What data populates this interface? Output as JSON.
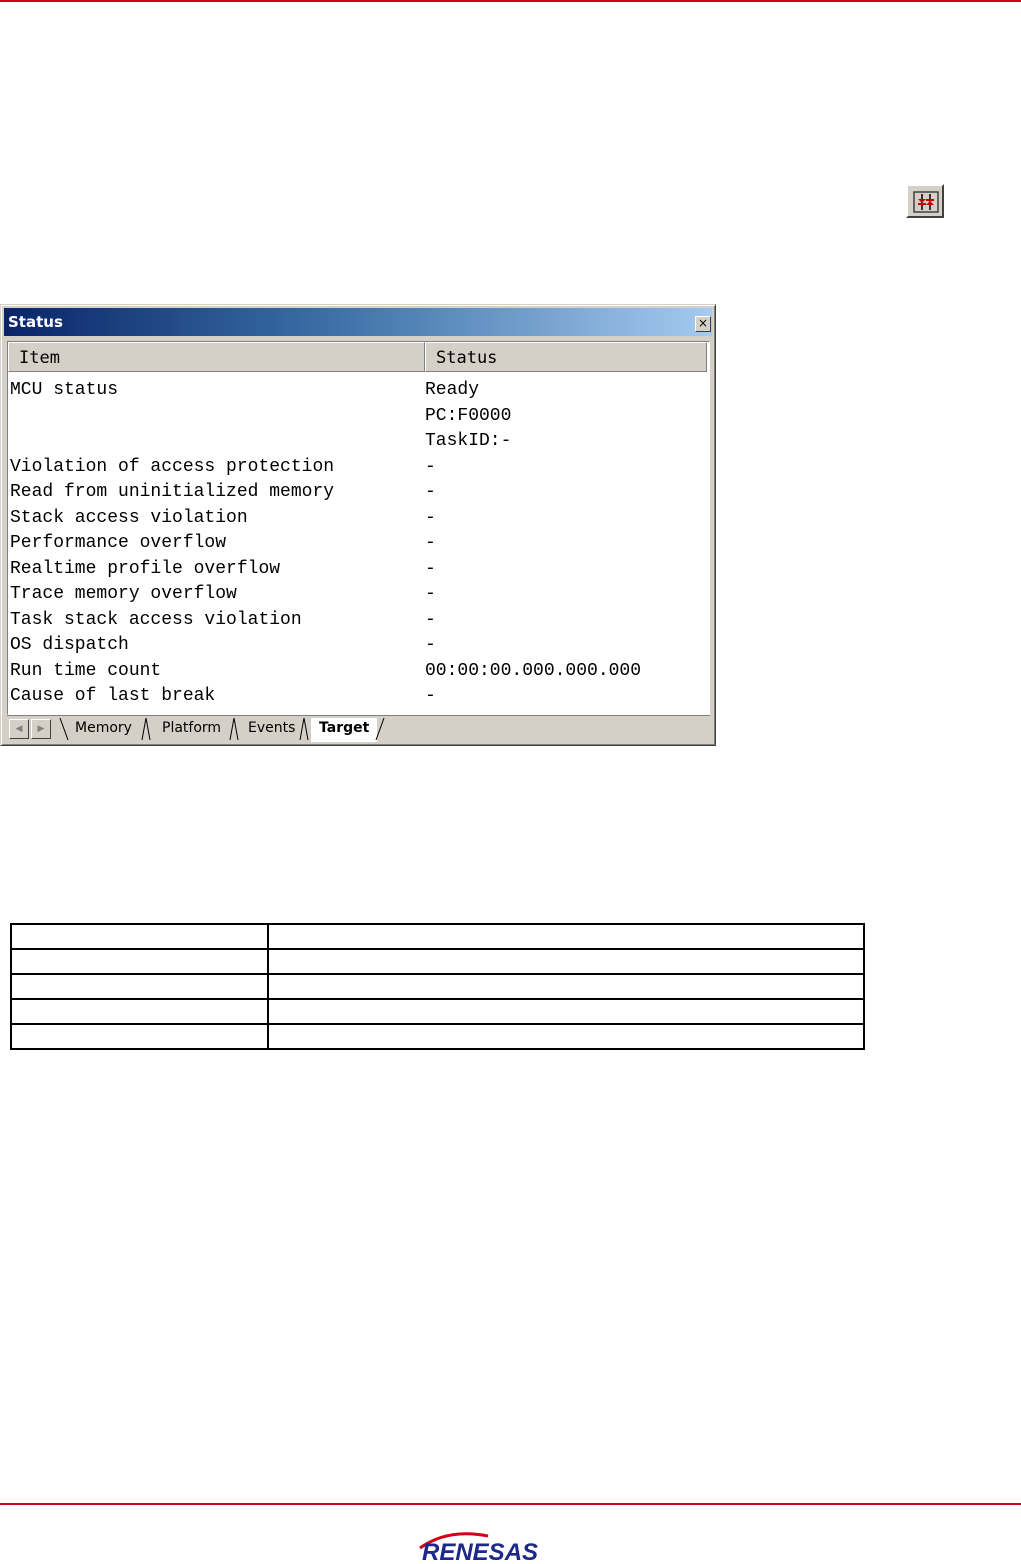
{
  "toolbar_icon": {
    "name": "status-window-icon",
    "color": "#c00000"
  },
  "window": {
    "title": "Status",
    "close_glyph": "×",
    "columns": {
      "item": "Item",
      "status": "Status"
    },
    "rows": [
      {
        "item": "MCU status",
        "status": "Ready"
      },
      {
        "item": "",
        "status": "PC:F0000"
      },
      {
        "item": "",
        "status": "TaskID:-"
      },
      {
        "item": "Violation of access protection",
        "status": "-"
      },
      {
        "item": "Read from uninitialized memory",
        "status": "-"
      },
      {
        "item": "Stack access violation",
        "status": "-"
      },
      {
        "item": "Performance overflow",
        "status": "-"
      },
      {
        "item": "Realtime profile overflow",
        "status": "-"
      },
      {
        "item": "Trace memory overflow",
        "status": "-"
      },
      {
        "item": "Task stack access violation",
        "status": "-"
      },
      {
        "item": "OS dispatch",
        "status": "-"
      },
      {
        "item": "Run time count",
        "status": "00:00:00.000.000.000"
      },
      {
        "item": "Cause of last break",
        "status": "-"
      }
    ],
    "tabs": [
      "Memory",
      "Platform",
      "Events",
      "Target"
    ],
    "active_tab": "Target"
  },
  "document_table": {
    "rows": 5,
    "cols": 2
  },
  "footer": {
    "logo_text": "RENESAS",
    "brand_color": "#1b2a8a",
    "rule_color": "#d0021b"
  }
}
